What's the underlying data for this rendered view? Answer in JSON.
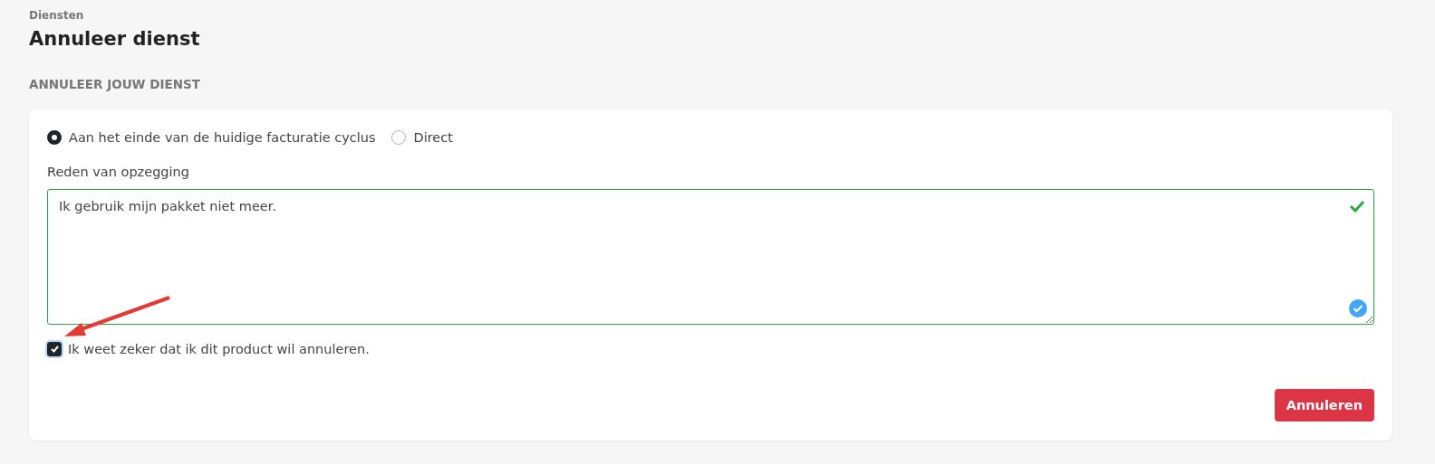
{
  "breadcrumb": "Diensten",
  "title": "Annuleer dienst",
  "section_heading": "ANNULEER JOUW DIENST",
  "timing_options": [
    {
      "label": "Aan het einde van de huidige facturatie cyclus",
      "selected": true
    },
    {
      "label": "Direct",
      "selected": false
    }
  ],
  "reason_field": {
    "label": "Reden van opzegging",
    "value": "Ik gebruik mijn pakket niet meer.",
    "valid": true
  },
  "confirm_checkbox": {
    "label": "Ik weet zeker dat ik dit product wil annuleren.",
    "checked": true
  },
  "submit_button": "Annuleren"
}
